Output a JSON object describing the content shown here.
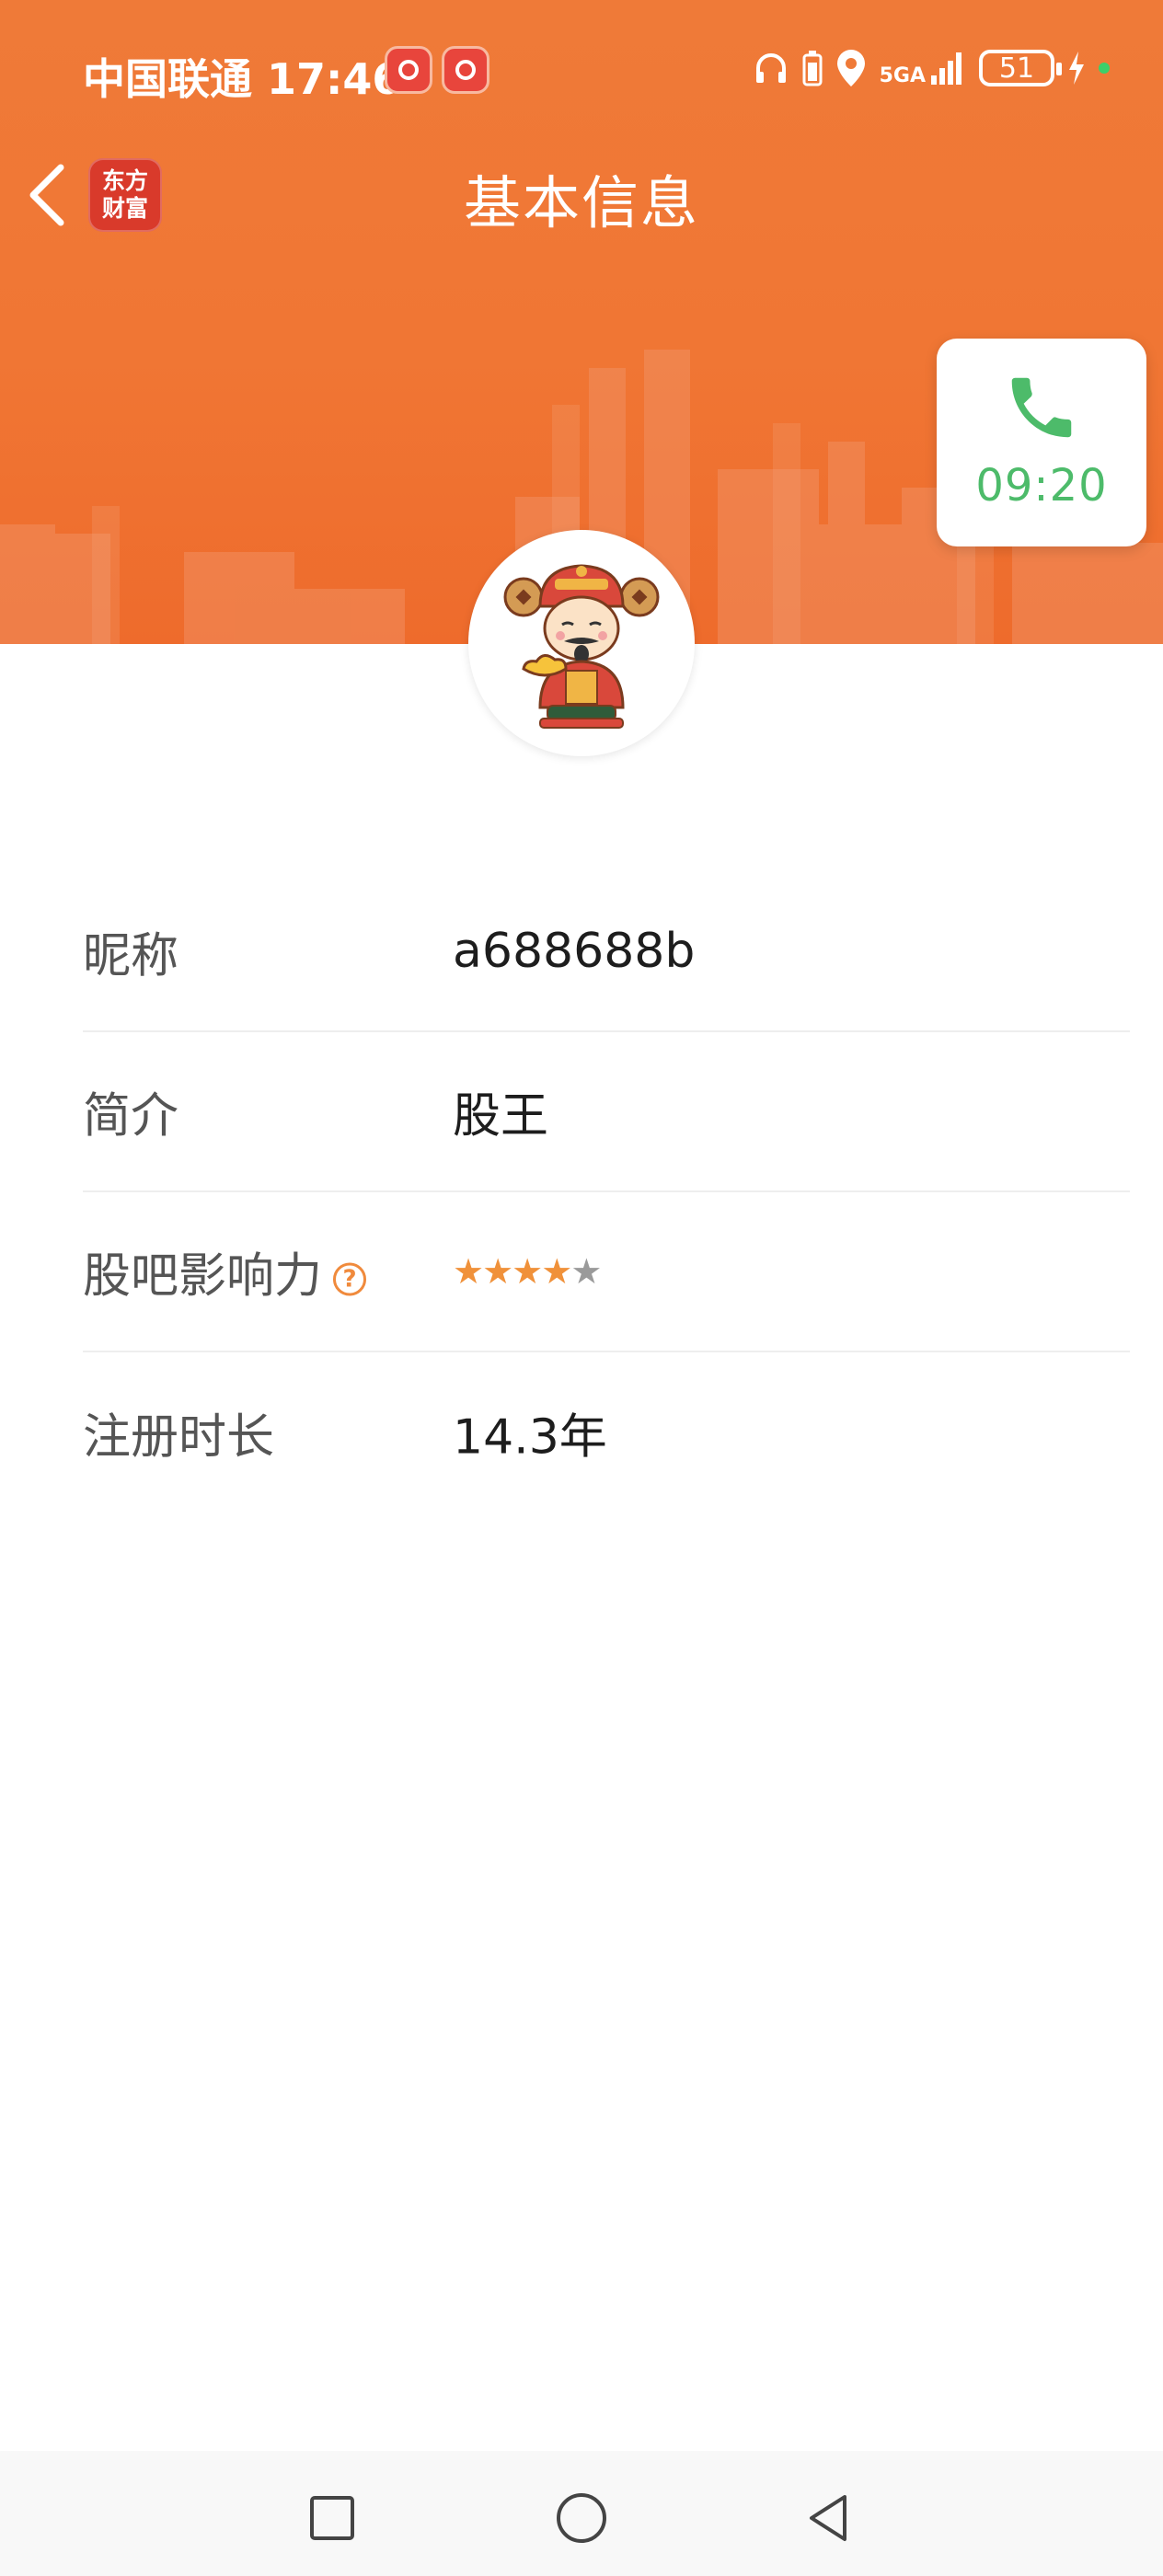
{
  "status_bar": {
    "carrier": "中国联通",
    "time": "17:46",
    "network": "5GA",
    "battery": "51"
  },
  "nav": {
    "app_logo_line1": "东方",
    "app_logo_line2": "财富",
    "title": "基本信息"
  },
  "call_widget": {
    "time": "09:20"
  },
  "profile": {
    "rows": [
      {
        "label": "昵称",
        "value": "a688688b"
      },
      {
        "label": "简介",
        "value": "股王"
      },
      {
        "label": "股吧影响力",
        "stars": 4,
        "max_stars": 5
      },
      {
        "label": "注册时长",
        "value": "14.3年"
      }
    ]
  },
  "colors": {
    "header": "#ef7a38",
    "accent": "#f08a3c",
    "call_green": "#4dbb6a"
  }
}
